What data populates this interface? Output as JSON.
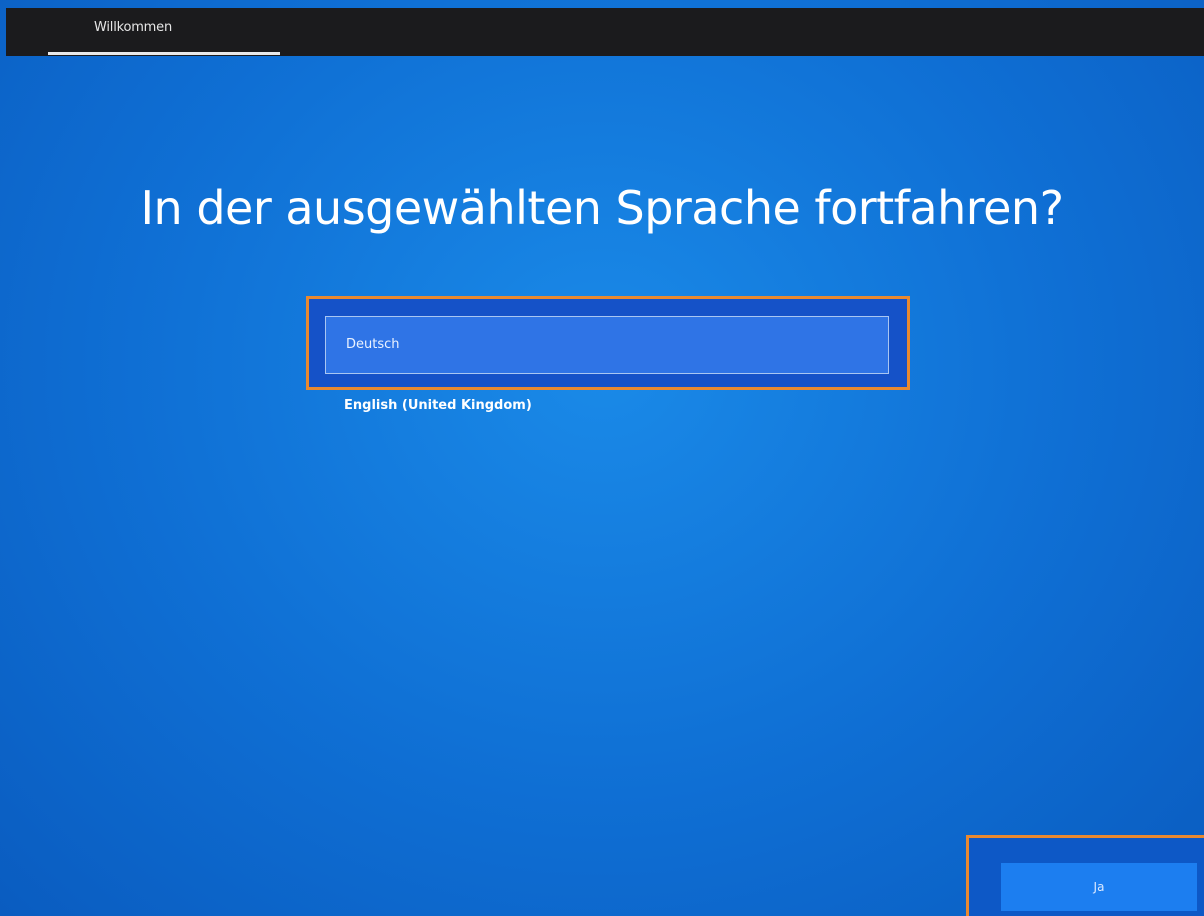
{
  "header": {
    "tab_label": "Willkommen"
  },
  "main": {
    "title": "In der ausgewählten Sprache fortfahren?",
    "languages": [
      {
        "label": "Deutsch",
        "selected": true
      },
      {
        "label": "English (United Kingdom)",
        "selected": false
      }
    ]
  },
  "footer": {
    "yes_label": "Ja"
  },
  "colors": {
    "background": "#0f6fd4",
    "topbar": "#1b1b1d",
    "highlight_border": "#e98930",
    "selected_item": "#2f74e6",
    "button": "#1c7ef0"
  }
}
